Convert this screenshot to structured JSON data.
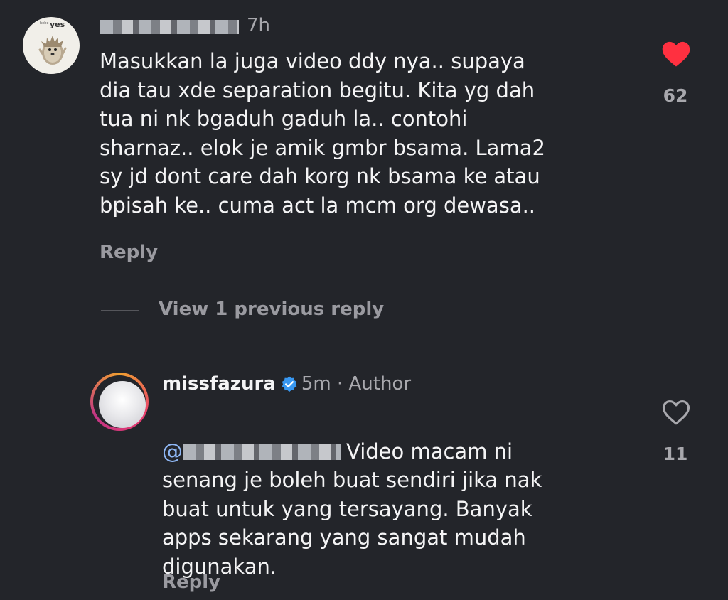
{
  "comments": [
    {
      "time": "7h",
      "text": "Masukkan la juga video ddy nya.. supaya\ndia tau xde separation begitu. Kita yg dah\ntua ni nk bgaduh gaduh la.. contohi\nsharnaz.. elok je amik gmbr bsama. Lama2\nsy jd dont care dah korg nk bsama ke atau\nbpisah ke.. cuma act la mcm org dewasa..",
      "likes": "62",
      "liked": true,
      "reply_label": "Reply",
      "avatar_text": "yes",
      "avatar_small_text": "hehe"
    },
    {
      "username": "missfazura",
      "time": "5m",
      "separator": "·",
      "author_label": "Author",
      "mention_prefix": "@",
      "text_first_line": "Video macam ni",
      "text_rest": "senang je boleh buat sendiri jika nak\nbuat untuk yang tersayang. Banyak\napps sekarang yang sangat mudah\ndigunakan.",
      "likes": "11",
      "liked": false,
      "reply_label": "Reply"
    }
  ],
  "view_replies_label": "View 1 previous reply",
  "colors": {
    "background": "#23252a",
    "liked_heart": "#ff3040",
    "verified": "#3897f0",
    "mention": "#8fb8f6"
  },
  "icons": {
    "liked": "heart-filled-icon",
    "unliked": "heart-outline-icon",
    "verified": "verified-badge-icon"
  }
}
